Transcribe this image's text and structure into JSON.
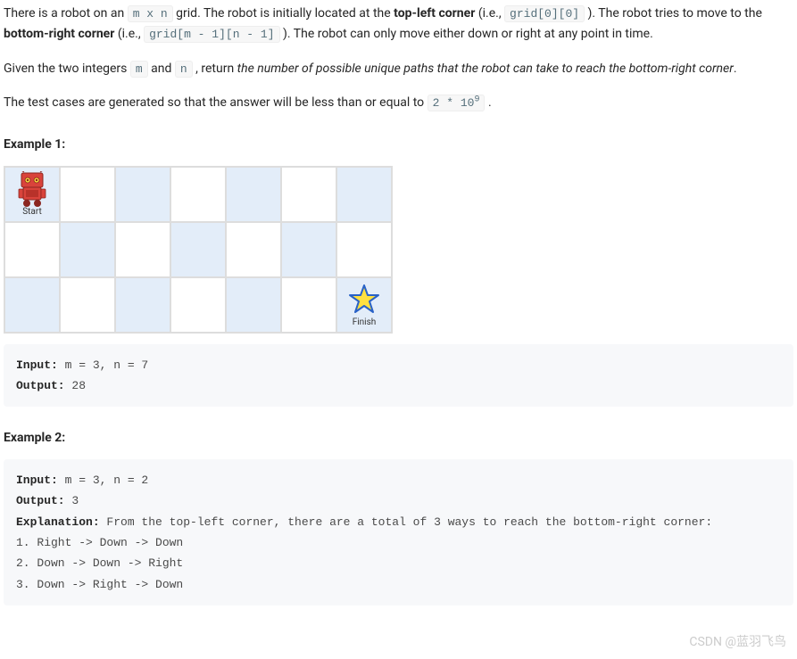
{
  "intro": {
    "p1_pre": "There is a robot on an ",
    "p1_code1": "m x n",
    "p1_mid1": " grid. The robot is initially located at the ",
    "p1_bold1": "top-left corner",
    "p1_mid2": " (i.e., ",
    "p1_code2": "grid[0][0]",
    "p1_mid3": " ). The robot tries to move to the ",
    "p1_bold2": "bottom-right corner",
    "p1_mid4": " (i.e., ",
    "p1_code3": "grid[m - 1][n - 1]",
    "p1_end": " ). The robot can only move either down or right at any point in time."
  },
  "para2": {
    "pre": "Given the two integers ",
    "code1": "m",
    "mid1": " and ",
    "code2": "n",
    "mid2": " , return ",
    "em": "the number of possible unique paths that the robot can take to reach the bottom-right corner",
    "end": "."
  },
  "para3": {
    "pre": "The test cases are generated so that the answer will be less than or equal to ",
    "code_base": "2 * 10",
    "code_sup": "9",
    "end": " ."
  },
  "example1": {
    "heading": "Example 1:",
    "start_label": "Start",
    "finish_label": "Finish",
    "input_label": "Input:",
    "input_val": " m = 3, n = 7",
    "output_label": "Output:",
    "output_val": " 28"
  },
  "example2": {
    "heading": "Example 2:",
    "input_label": "Input:",
    "input_val": " m = 3, n = 2",
    "output_label": "Output:",
    "output_val": " 3",
    "explanation_label": "Explanation:",
    "explanation_text": " From the top-left corner, there are a total of 3 ways to reach the bottom-right corner:",
    "paths": [
      "1. Right -> Down -> Down",
      "2. Down -> Down -> Right",
      "3. Down -> Right -> Down"
    ]
  },
  "watermark": "CSDN @蓝羽飞鸟"
}
